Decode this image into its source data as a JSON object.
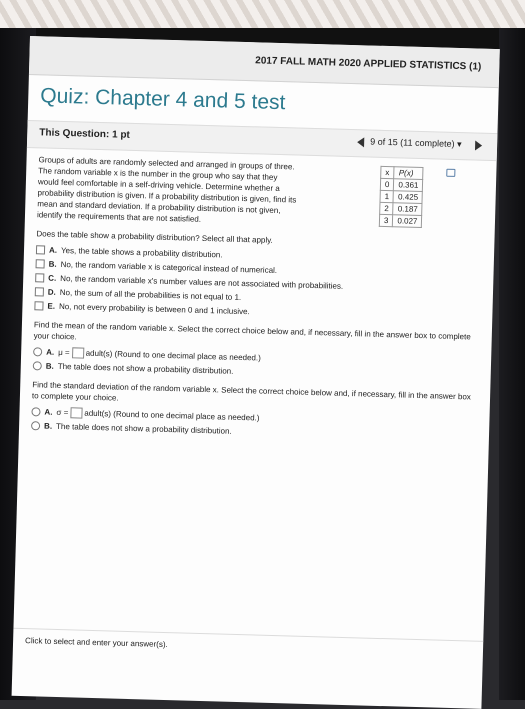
{
  "header": {
    "course_title": "2017 FALL MATH 2020 APPLIED STATISTICS (1)",
    "quiz_title": "Quiz: Chapter 4 and 5 test"
  },
  "question_bar": {
    "this_question": "This Question: 1 pt",
    "progress_main": "9 of 15 (11 complete)",
    "progress_dropdown": "▾"
  },
  "problem": {
    "lines": [
      "Groups of adults are randomly selected and arranged in groups of three.",
      "The random variable x is the number in the group who say that they",
      "would feel comfortable in a self-driving vehicle. Determine whether a",
      "probability distribution is given. If a probability distribution is given, find its",
      "mean and standard deviation. If a probability distribution is not given,",
      "identify the requirements that are not satisfied."
    ],
    "table": {
      "headers": [
        "x",
        "P(x)"
      ],
      "rows": [
        [
          "0",
          "0.361"
        ],
        [
          "1",
          "0.425"
        ],
        [
          "2",
          "0.187"
        ],
        [
          "3",
          "0.027"
        ]
      ]
    }
  },
  "question1": {
    "prompt": "Does the table show a probability distribution? Select all that apply.",
    "choices": [
      {
        "letter": "A.",
        "text": "Yes, the table shows a probability distribution."
      },
      {
        "letter": "B.",
        "text": "No, the random variable x is categorical instead of numerical."
      },
      {
        "letter": "C.",
        "text": "No, the random variable x's number values are not associated with probabilities."
      },
      {
        "letter": "D.",
        "text": "No, the sum of all the probabilities is not equal to 1."
      },
      {
        "letter": "E.",
        "text": "No, not every probability is between 0 and 1 inclusive."
      }
    ]
  },
  "question2": {
    "prompt": "Find the mean of the random variable x. Select the correct choice below and, if necessary, fill in the answer box to complete your choice.",
    "choice_a_prefix": "μ =",
    "choice_a_suffix": "adult(s) (Round to one decimal place as needed.)",
    "choice_b": "The table does not show a probability distribution."
  },
  "question3": {
    "prompt": "Find the standard deviation of the random variable x. Select the correct choice below and, if necessary, fill in the answer box to complete your choice.",
    "choice_a_prefix": "σ =",
    "choice_a_suffix": "adult(s) (Round to one decimal place as needed.)",
    "choice_b": "The table does not show a probability distribution."
  },
  "footer": {
    "instruction": "Click to select and enter your answer(s)."
  }
}
